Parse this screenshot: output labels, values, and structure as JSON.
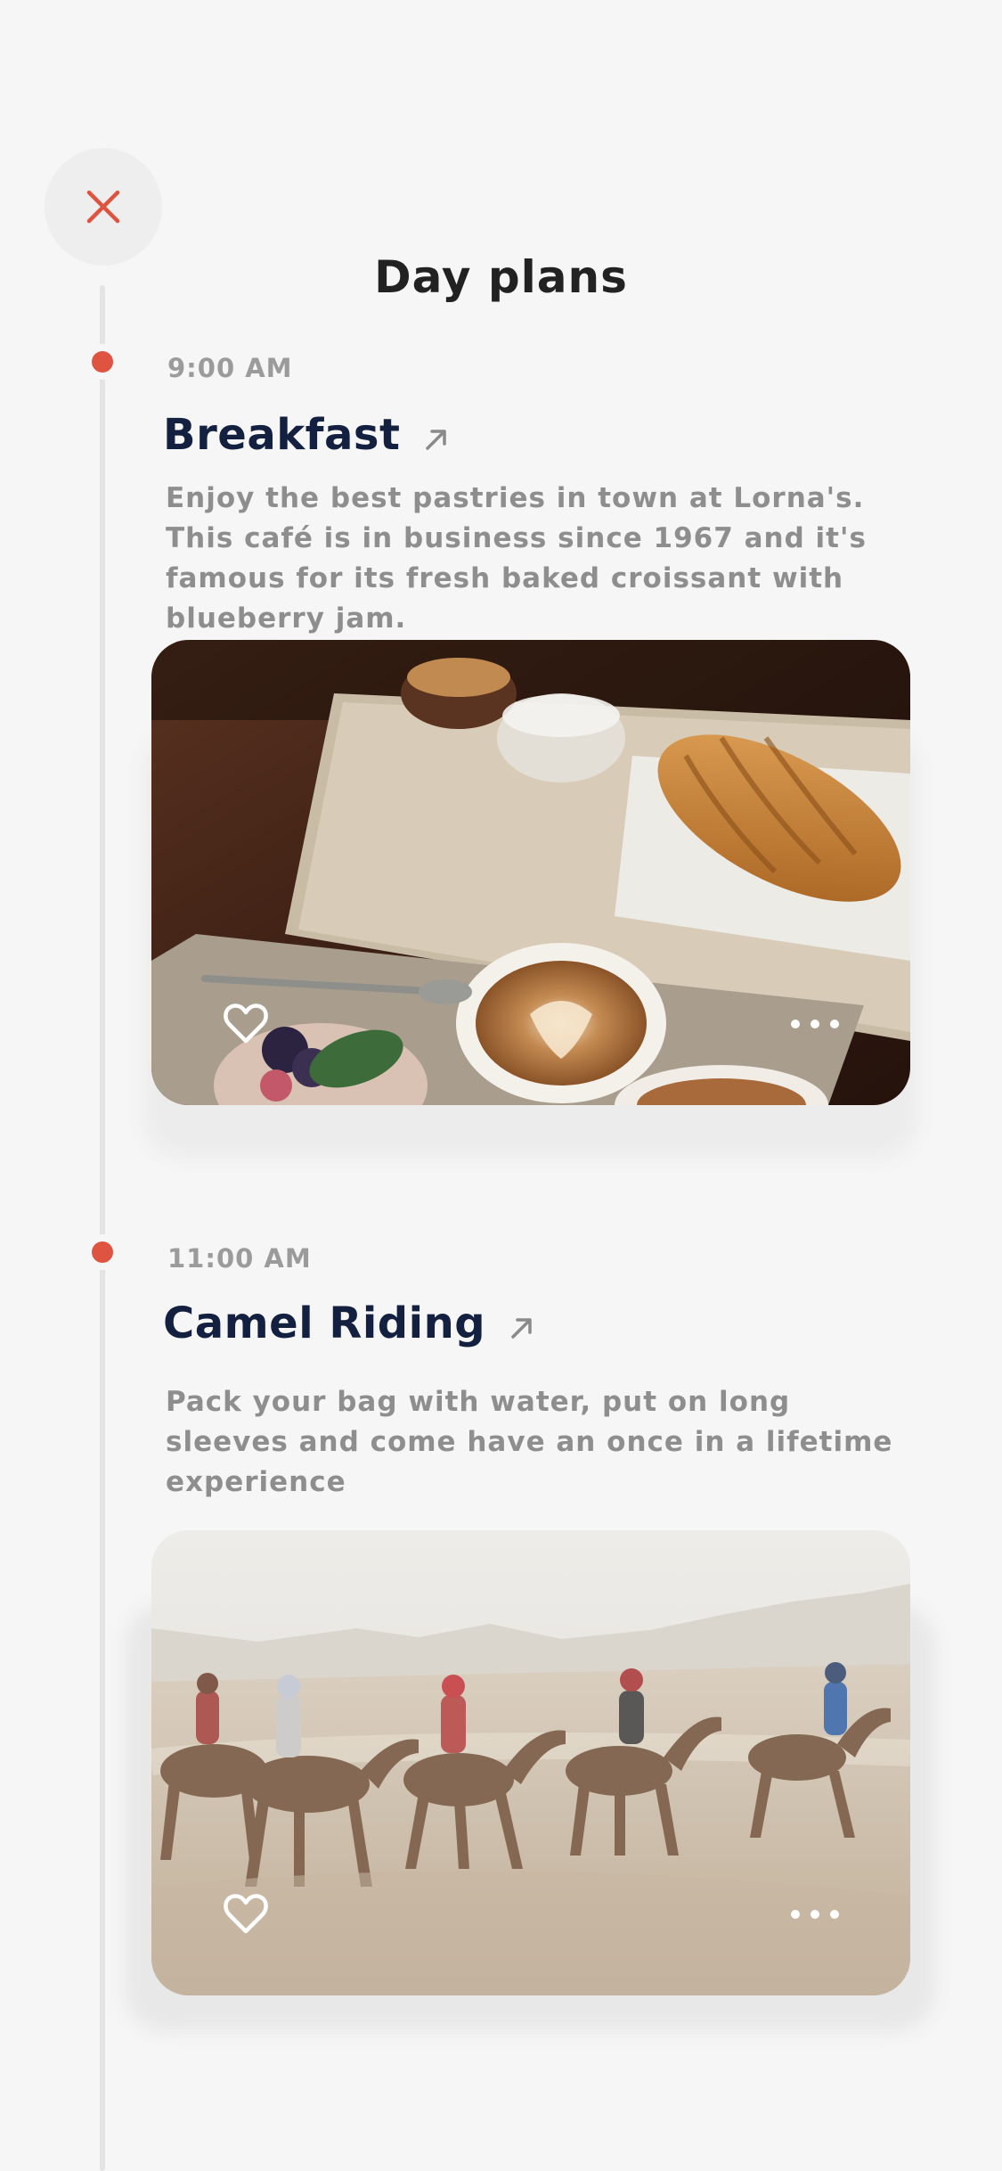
{
  "header": {
    "title": "Day plans"
  },
  "icons": {
    "close": "close-icon",
    "external": "arrow-up-right-icon",
    "favorite": "heart-outline-icon",
    "more": "more-horizontal-icon"
  },
  "colors": {
    "accent": "#df5440",
    "title": "#14203f",
    "muted": "#8e8e8e"
  },
  "events": [
    {
      "time": "9:00 AM",
      "title": "Breakfast",
      "description": "Enjoy the best pastries in town at Lorna's. This café is in business since 1967 and it's famous for its fresh baked croissant with blueberry jam.",
      "image": "breakfast-photo"
    },
    {
      "time": "11:00 AM",
      "title": "Camel Riding",
      "description": "Pack your bag with water, put on long sleeves and come have an once in a lifetime experience",
      "image": "camel-caravan-photo"
    }
  ]
}
